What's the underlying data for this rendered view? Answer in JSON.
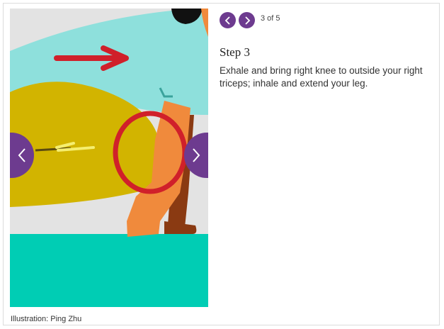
{
  "pager": {
    "prev_icon": "chevron-left-icon",
    "next_icon": "chevron-right-icon",
    "counter": "3 of 5"
  },
  "step": {
    "title": "Step 3",
    "description": "Exhale and bring right knee to outside your right triceps; inhale and extend your leg."
  },
  "caption": "Illustration: Ping Zhu",
  "colors": {
    "accent": "#6d3b8f",
    "background_wall": "#e3e3e3",
    "floor": "#00cdb4",
    "shirt": "#8ee0dc",
    "pants": "#d2b400",
    "skin": "#f08a3c",
    "leg_shadow": "#8a3a12",
    "annotation_red": "#d0202a",
    "annotation_yellow": "#f5ee70"
  }
}
